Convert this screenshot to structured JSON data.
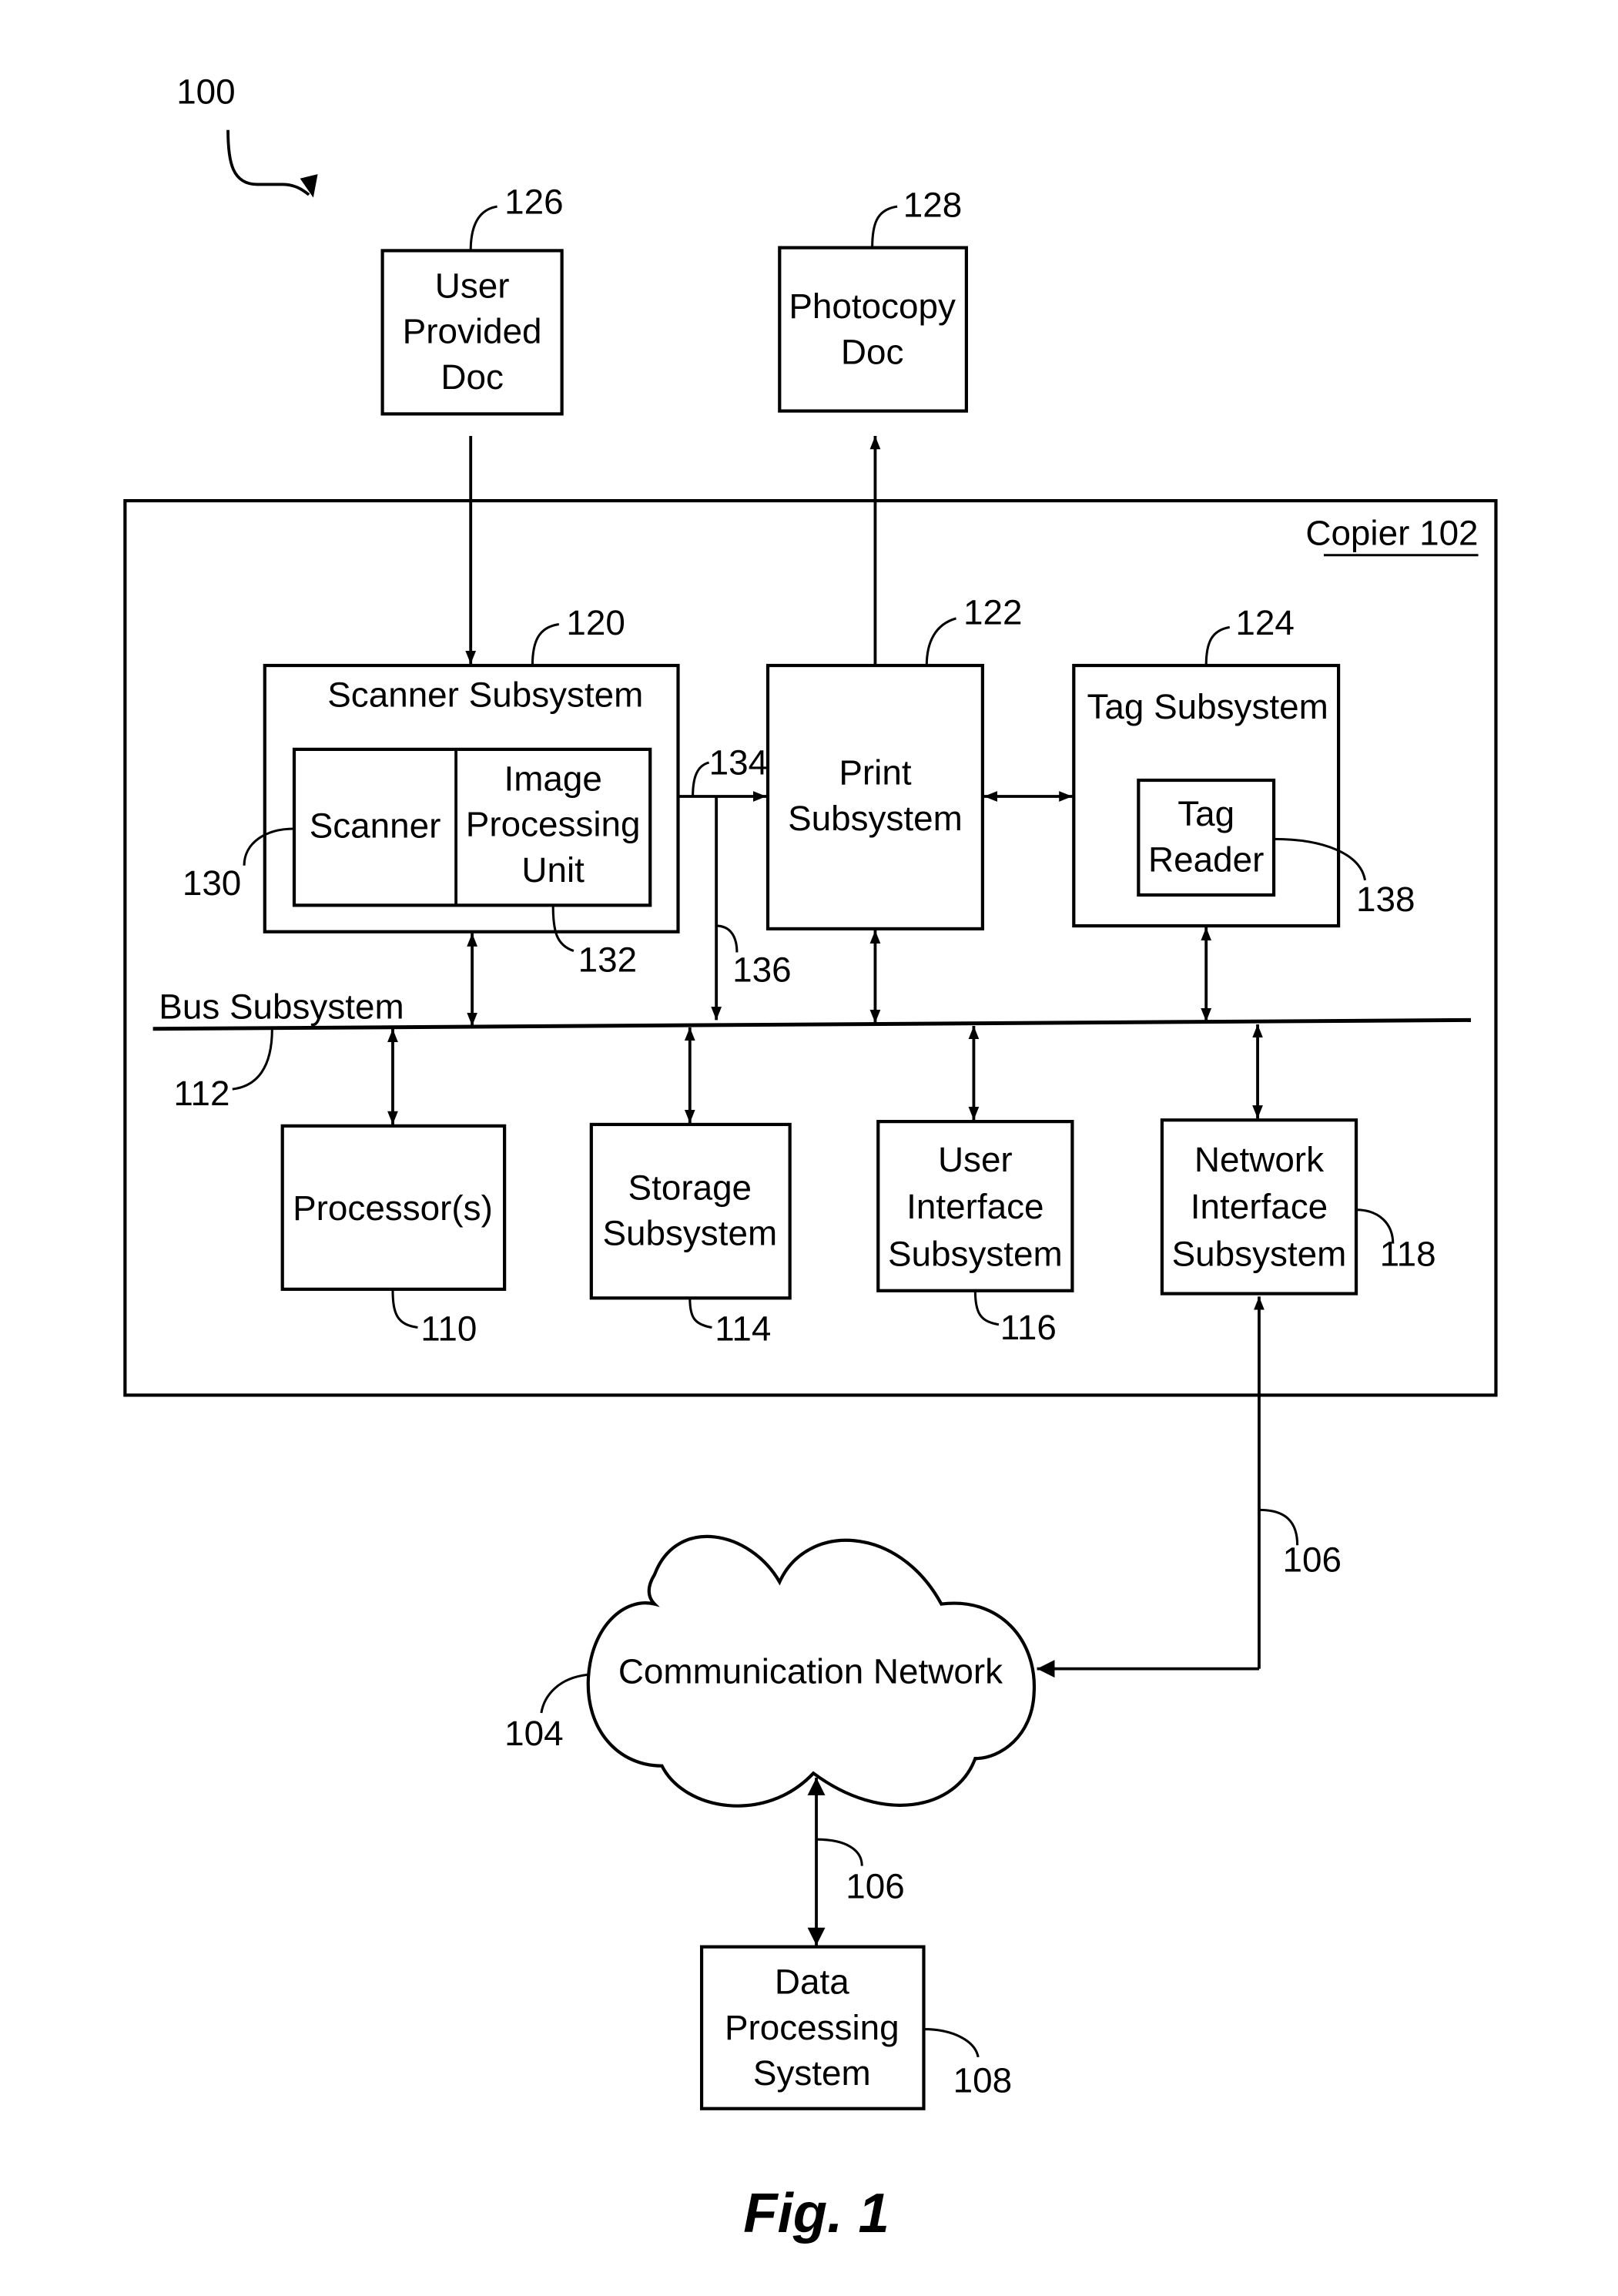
{
  "figure": {
    "caption": "Fig. 1",
    "system_ref": "100"
  },
  "blocks": {
    "user_doc": {
      "lines": [
        "User",
        "Provided",
        "Doc"
      ],
      "ref": "126"
    },
    "photocopy_doc": {
      "lines": [
        "Photocopy",
        "Doc"
      ],
      "ref": "128"
    },
    "copier": {
      "label": "Copier 102"
    },
    "scanner_subsystem": {
      "label": "Scanner Subsystem",
      "ref": "120"
    },
    "scanner": {
      "label": "Scanner",
      "ref": "130"
    },
    "image_processing_unit": {
      "lines": [
        "Image",
        "Processing",
        "Unit"
      ],
      "ref": "132"
    },
    "print_subsystem": {
      "lines": [
        "Print",
        "Subsystem"
      ],
      "ref": "122"
    },
    "tag_subsystem": {
      "label": "Tag Subsystem",
      "ref": "124"
    },
    "tag_reader": {
      "lines": [
        "Tag",
        "Reader"
      ],
      "ref": "138"
    },
    "bus_subsystem": {
      "label": "Bus Subsystem",
      "ref": "112"
    },
    "processor": {
      "label": "Processor(s)",
      "ref": "110"
    },
    "storage_subsystem": {
      "lines": [
        "Storage",
        "Subsystem"
      ],
      "ref": "114"
    },
    "user_interface_subsystem": {
      "lines": [
        "User",
        "Interface",
        "Subsystem"
      ],
      "ref": "116"
    },
    "network_interface_subsystem": {
      "lines": [
        "Network",
        "Interface",
        "Subsystem"
      ],
      "ref": "118"
    },
    "communication_network": {
      "label": "Communication Network",
      "ref": "104"
    },
    "data_processing_system": {
      "lines": [
        "Data",
        "Processing",
        "System"
      ],
      "ref": "108"
    }
  },
  "connections": {
    "scanner_to_print_ref": "134",
    "scanner_to_bus_ref": "136",
    "network_link_ref_upper": "106",
    "network_link_ref_lower": "106"
  }
}
